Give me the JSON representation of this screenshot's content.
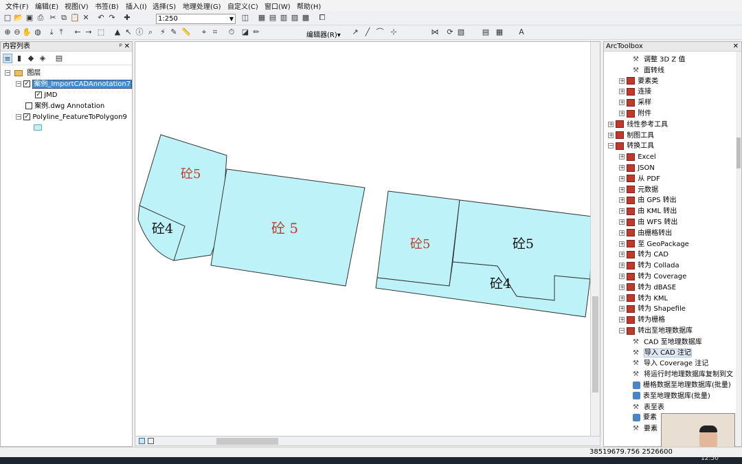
{
  "menu": [
    "文件(F)",
    "编辑(E)",
    "视图(V)",
    "书签(B)",
    "插入(I)",
    "选择(S)",
    "地理处理(G)",
    "自定义(C)",
    "窗口(W)",
    "帮助(H)"
  ],
  "toolbar": {
    "scale": "1:250",
    "editor_label": "编辑器(R)▾"
  },
  "toc": {
    "title": "内容列表",
    "root": "图层",
    "layers": [
      {
        "label": "案例_ImportCADAnnotation7",
        "checked": true,
        "selected": true
      },
      {
        "label": "JMD",
        "checked": true,
        "child": true
      },
      {
        "label": "案例.dwg Annotation",
        "checked": false
      },
      {
        "label": "Polyline_FeatureToPolygon9",
        "checked": true
      }
    ],
    "symbol_color": "#bdf3f8"
  },
  "map": {
    "fill": "#bdf3f8",
    "labels": [
      "砼5",
      "砼 5",
      "砼4",
      "砼5",
      "砼5",
      "砼4"
    ]
  },
  "toolbox": {
    "title": "ArcToolbox",
    "items": [
      {
        "label": "调整 3D Z 值",
        "icon": "hammer",
        "indent": 3
      },
      {
        "label": "面转线",
        "icon": "hammer",
        "indent": 3
      },
      {
        "label": "要素类",
        "icon": "box",
        "indent": 2,
        "exp": "+"
      },
      {
        "label": "连接",
        "icon": "box",
        "indent": 2,
        "exp": "+"
      },
      {
        "label": "采样",
        "icon": "box",
        "indent": 2,
        "exp": "+"
      },
      {
        "label": "附件",
        "icon": "box",
        "indent": 2,
        "exp": "+"
      },
      {
        "label": "线性参考工具",
        "icon": "box",
        "indent": 1,
        "exp": "+"
      },
      {
        "label": "制图工具",
        "icon": "box",
        "indent": 1,
        "exp": "+"
      },
      {
        "label": "转换工具",
        "icon": "box",
        "indent": 1,
        "exp": "-"
      },
      {
        "label": "Excel",
        "icon": "box",
        "indent": 2,
        "exp": "+"
      },
      {
        "label": "JSON",
        "icon": "box",
        "indent": 2,
        "exp": "+"
      },
      {
        "label": "从 PDF",
        "icon": "box",
        "indent": 2,
        "exp": "+"
      },
      {
        "label": "元数据",
        "icon": "box",
        "indent": 2,
        "exp": "+"
      },
      {
        "label": "由 GPS 转出",
        "icon": "box",
        "indent": 2,
        "exp": "+"
      },
      {
        "label": "由 KML 转出",
        "icon": "box",
        "indent": 2,
        "exp": "+"
      },
      {
        "label": "由 WFS 转出",
        "icon": "box",
        "indent": 2,
        "exp": "+"
      },
      {
        "label": "由栅格转出",
        "icon": "box",
        "indent": 2,
        "exp": "+"
      },
      {
        "label": "至 GeoPackage",
        "icon": "box",
        "indent": 2,
        "exp": "+"
      },
      {
        "label": "转为 CAD",
        "icon": "box",
        "indent": 2,
        "exp": "+"
      },
      {
        "label": "转为 Collada",
        "icon": "box",
        "indent": 2,
        "exp": "+"
      },
      {
        "label": "转为 Coverage",
        "icon": "box",
        "indent": 2,
        "exp": "+"
      },
      {
        "label": "转为 dBASE",
        "icon": "box",
        "indent": 2,
        "exp": "+"
      },
      {
        "label": "转为 KML",
        "icon": "box",
        "indent": 2,
        "exp": "+"
      },
      {
        "label": "转为 Shapefile",
        "icon": "box",
        "indent": 2,
        "exp": "+"
      },
      {
        "label": "转为栅格",
        "icon": "box",
        "indent": 2,
        "exp": "+"
      },
      {
        "label": "转出至地理数据库",
        "icon": "box",
        "indent": 2,
        "exp": "-"
      },
      {
        "label": "CAD 至地理数据库",
        "icon": "hammer",
        "indent": 3
      },
      {
        "label": "导入 CAD 注记",
        "icon": "hammer",
        "indent": 3,
        "hl": true
      },
      {
        "label": "导入 Coverage 注记",
        "icon": "hammer",
        "indent": 3
      },
      {
        "label": "将运行时地理数据库复制到文",
        "icon": "hammer",
        "indent": 3
      },
      {
        "label": "栅格数据至地理数据库(批量)",
        "icon": "script",
        "indent": 3
      },
      {
        "label": "表至地理数据库(批量)",
        "icon": "script",
        "indent": 3
      },
      {
        "label": "表至表",
        "icon": "hammer",
        "indent": 3
      },
      {
        "label": "要素",
        "icon": "script",
        "indent": 3
      },
      {
        "label": "要素",
        "icon": "hammer",
        "indent": 3
      }
    ]
  },
  "status": {
    "coords": "38519679.756  2526600",
    "time": "12:50"
  }
}
